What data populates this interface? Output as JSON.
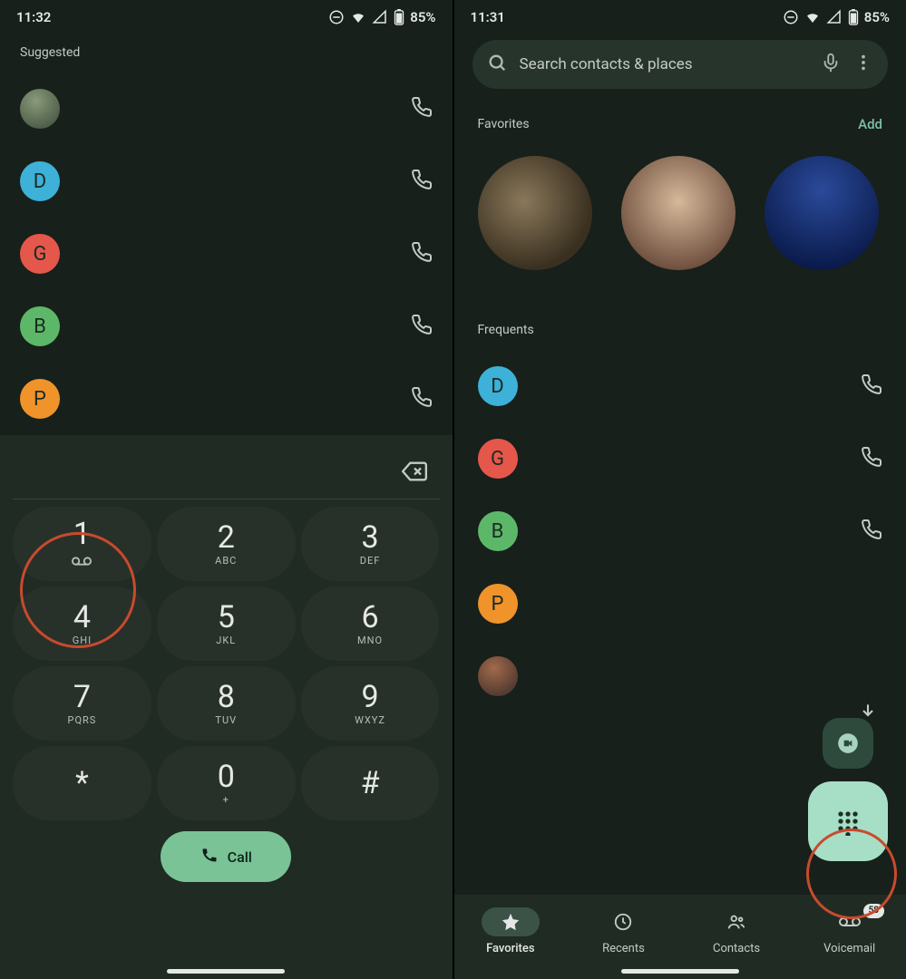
{
  "left": {
    "status": {
      "time": "11:32",
      "battery": "85%"
    },
    "suggested_label": "Suggested",
    "suggested": [
      {
        "letter": "",
        "color": "photo"
      },
      {
        "letter": "D",
        "color": "#3db1d8"
      },
      {
        "letter": "G",
        "color": "#e5574b"
      },
      {
        "letter": "B",
        "color": "#5cb868"
      },
      {
        "letter": "P",
        "color": "#f0932b"
      }
    ],
    "dialpad": [
      {
        "digit": "1",
        "letters": "",
        "vm": true
      },
      {
        "digit": "2",
        "letters": "ABC"
      },
      {
        "digit": "3",
        "letters": "DEF"
      },
      {
        "digit": "4",
        "letters": "GHI"
      },
      {
        "digit": "5",
        "letters": "JKL"
      },
      {
        "digit": "6",
        "letters": "MNO"
      },
      {
        "digit": "7",
        "letters": "PQRS"
      },
      {
        "digit": "8",
        "letters": "TUV"
      },
      {
        "digit": "9",
        "letters": "WXYZ"
      },
      {
        "digit": "*",
        "letters": ""
      },
      {
        "digit": "0",
        "letters": "+"
      },
      {
        "digit": "#",
        "letters": ""
      }
    ],
    "call_label": "Call"
  },
  "right": {
    "status": {
      "time": "11:31",
      "battery": "85%"
    },
    "search_placeholder": "Search contacts & places",
    "favorites_label": "Favorites",
    "add_label": "Add",
    "frequents_label": "Frequents",
    "frequents": [
      {
        "letter": "D",
        "color": "#3db1d8"
      },
      {
        "letter": "G",
        "color": "#e5574b"
      },
      {
        "letter": "B",
        "color": "#5cb868"
      },
      {
        "letter": "P",
        "color": "#f0932b"
      },
      {
        "letter": "",
        "color": "photo"
      }
    ],
    "nav": [
      {
        "label": "Favorites",
        "active": true
      },
      {
        "label": "Recents",
        "active": false
      },
      {
        "label": "Contacts",
        "active": false
      },
      {
        "label": "Voicemail",
        "active": false,
        "badge": "58"
      }
    ]
  }
}
